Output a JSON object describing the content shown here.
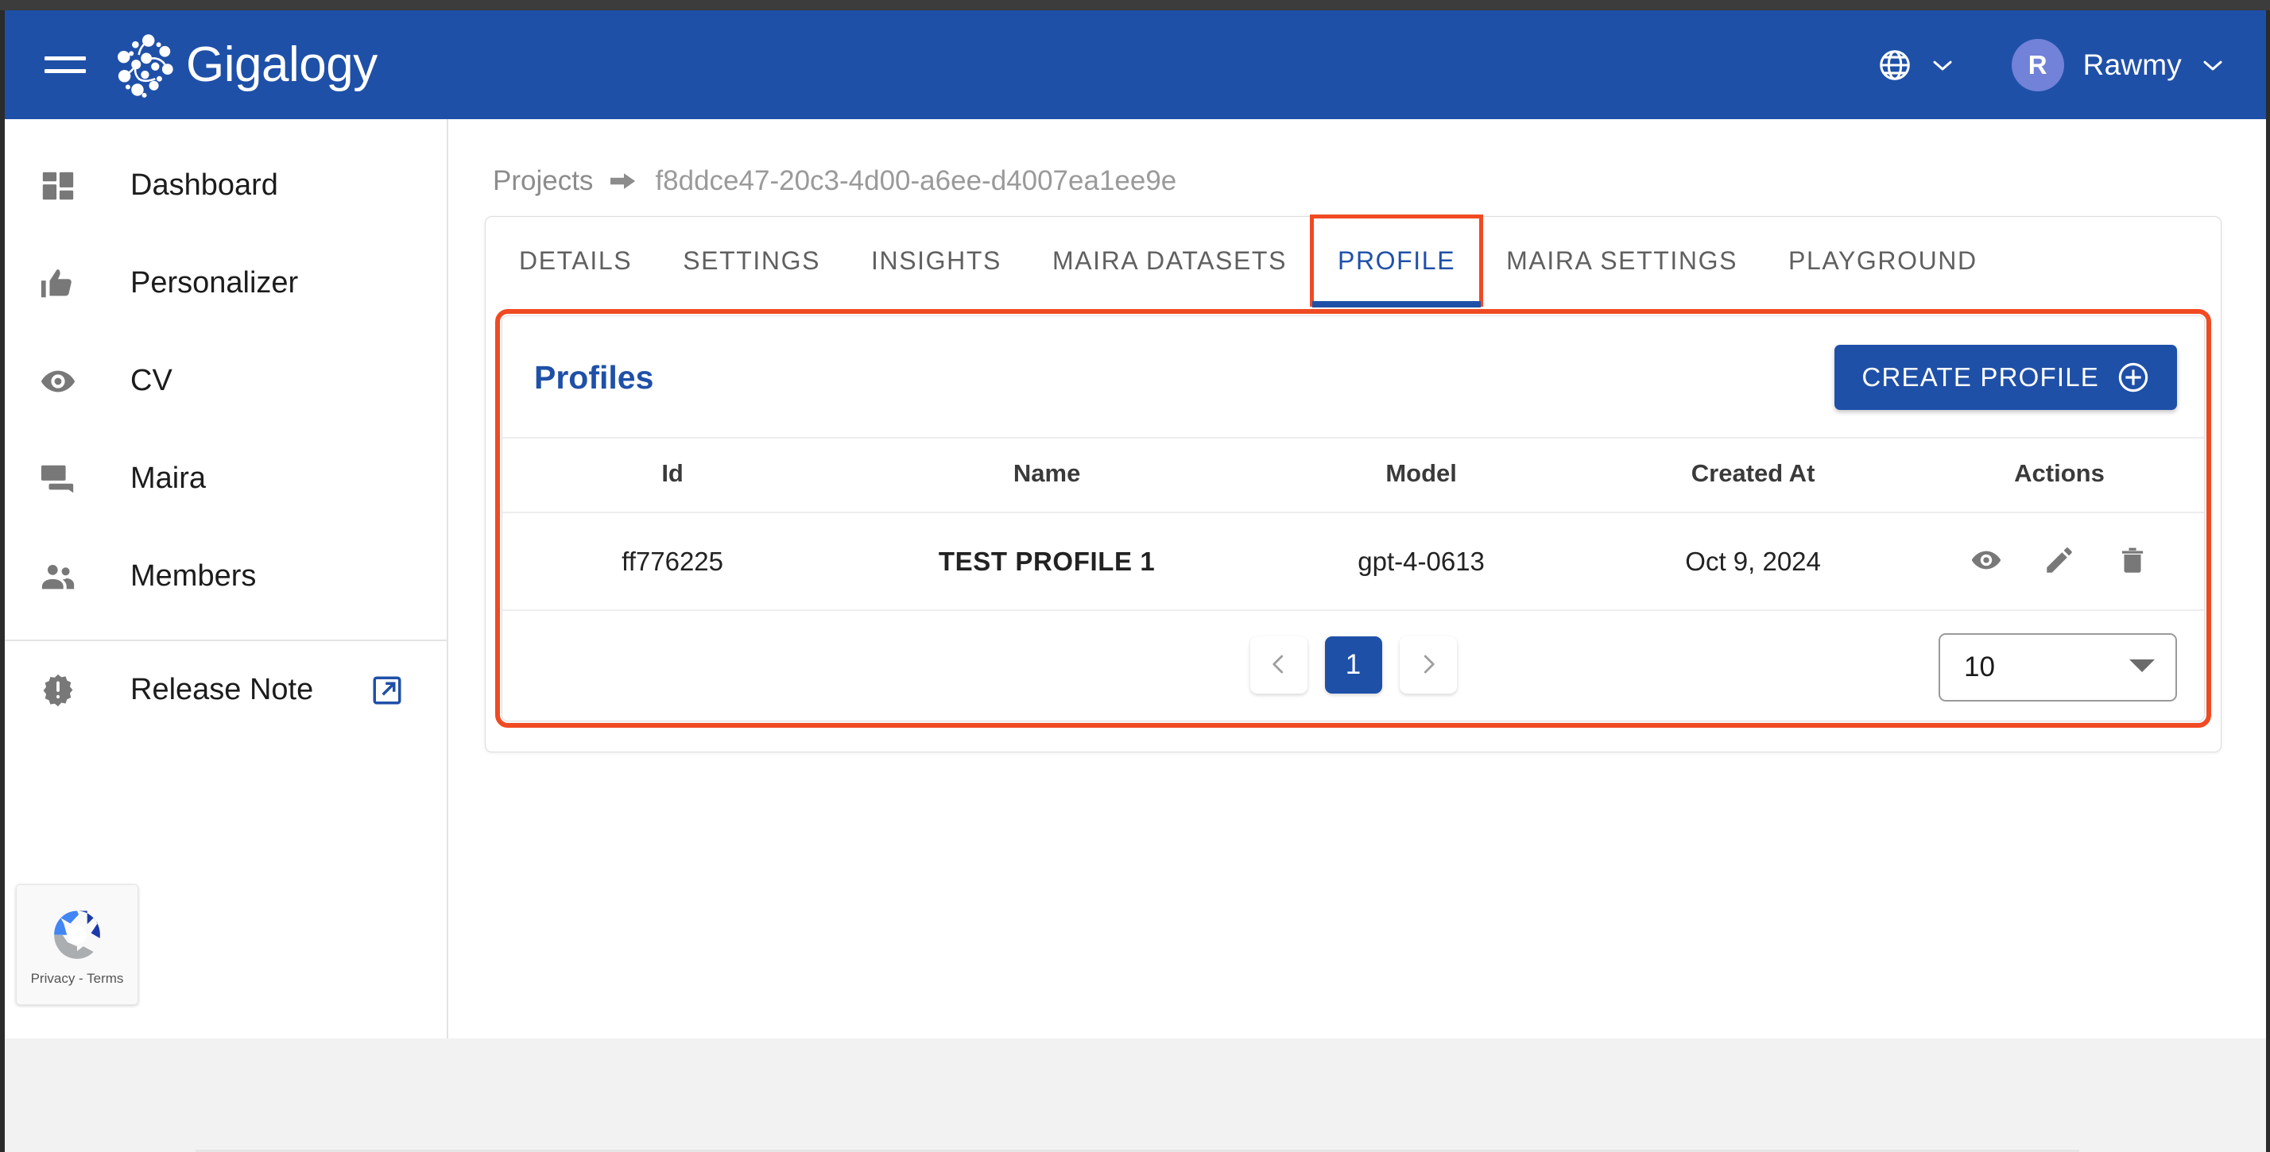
{
  "browser": {
    "chrome_color": "#3c3c3c"
  },
  "colors": {
    "brand_blue": "#1f50a8",
    "highlight_red": "#f04a23",
    "avatar_purple": "#7182d8",
    "name_link": "#1a3a8f"
  },
  "topbar": {
    "menu_icon": "hamburger-menu-icon",
    "brand_name": "Gigalogy",
    "brand_logo_icon": "gigalogy-logo-icon",
    "language_icon": "globe-icon",
    "language_caret_icon": "chevron-down-icon",
    "user": {
      "avatar_initial": "R",
      "name": "Rawmy",
      "caret_icon": "chevron-down-icon"
    }
  },
  "sidebar": {
    "items": [
      {
        "label": "Dashboard",
        "icon": "dashboard-grid-icon"
      },
      {
        "label": "Personalizer",
        "icon": "thumbs-up-icon"
      },
      {
        "label": "CV",
        "icon": "eye-icon"
      },
      {
        "label": "Maira",
        "icon": "chat-bubbles-icon"
      },
      {
        "label": "Members",
        "icon": "people-group-icon"
      }
    ],
    "release_note": {
      "label": "Release Note",
      "icon": "alert-badge-icon",
      "external_icon": "open-in-new-icon"
    },
    "recaptcha": {
      "text": "Privacy - Terms",
      "icon": "recaptcha-logo-icon"
    }
  },
  "breadcrumb": {
    "root": "Projects",
    "arrow_icon": "arrow-right-icon",
    "current": "f8ddce47-20c3-4d00-a6ee-d4007ea1ee9e"
  },
  "tabs": [
    {
      "label": "DETAILS",
      "active": false
    },
    {
      "label": "SETTINGS",
      "active": false
    },
    {
      "label": "INSIGHTS",
      "active": false
    },
    {
      "label": "MAIRA DATASETS",
      "active": false
    },
    {
      "label": "PROFILE",
      "active": true
    },
    {
      "label": "MAIRA SETTINGS",
      "active": false
    },
    {
      "label": "PLAYGROUND",
      "active": false
    }
  ],
  "profiles_card": {
    "title": "Profiles",
    "create_button": {
      "label": "CREATE PROFILE",
      "icon": "plus-circle-icon"
    },
    "table": {
      "headers": [
        "Id",
        "Name",
        "Model",
        "Created At",
        "Actions"
      ],
      "rows": [
        {
          "id": "ff776225",
          "name": "TEST PROFILE 1",
          "model": "gpt-4-0613",
          "created_at": "Oct 9, 2024",
          "actions": [
            "view-icon",
            "edit-icon",
            "delete-icon"
          ]
        }
      ]
    },
    "pagination": {
      "prev_icon": "chevron-left-icon",
      "next_icon": "chevron-right-icon",
      "pages": [
        "1"
      ],
      "current_page": "1",
      "rows_per_page": "10",
      "rows_caret_icon": "caret-down-icon"
    }
  }
}
